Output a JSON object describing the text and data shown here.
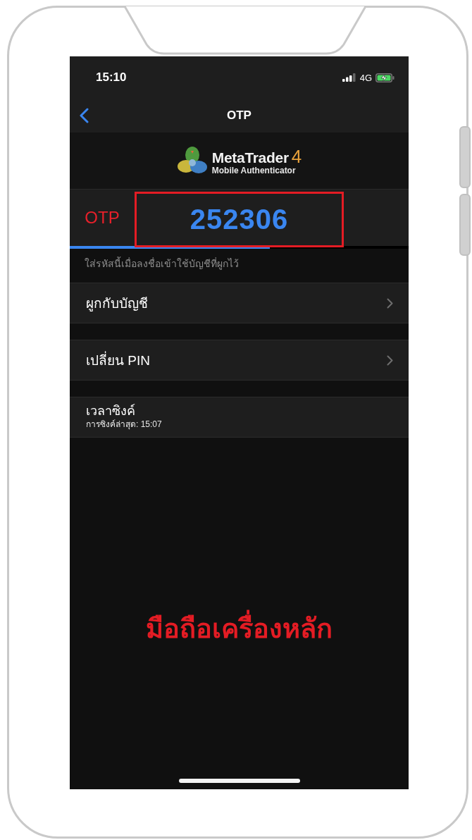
{
  "status_bar": {
    "time": "15:10",
    "network": "4G"
  },
  "nav": {
    "title": "OTP"
  },
  "logo": {
    "name": "MetaTrader",
    "version": "4",
    "subtitle": "Mobile Authenticator"
  },
  "otp": {
    "label": "OTP",
    "code": "252306",
    "level": 0.59,
    "highlighted": true
  },
  "hint": "ใส่รหัสนี้เมื่อลงชื่อเข้าใช้บัญชีที่ผูกไว้",
  "menu": [
    {
      "kind": "link",
      "label": "ผูกกับบัญชี"
    },
    {
      "kind": "link",
      "label": "เปลี่ยน PIN"
    },
    {
      "kind": "info",
      "label": "เวลาซิงค์",
      "detail": "การซิงค์ล่าสุด: 15:07"
    }
  ],
  "caption": "มือถือเครื่องหลัก"
}
